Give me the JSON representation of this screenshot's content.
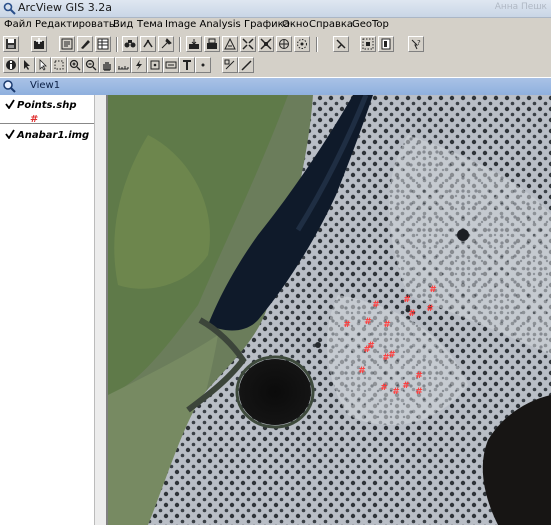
{
  "window": {
    "title": "ArcView GIS 3.2a",
    "faded_corner_text": "Анна Пешк"
  },
  "menu": [
    "Файл",
    "Редактировать",
    "Вид",
    "Тема",
    "Image Analysis",
    "Графика",
    "Окно",
    "Справка",
    "GeoTop"
  ],
  "toolbar1": [
    "save-icon",
    "add-theme-icon",
    "theme-properties-icon",
    "edit-legend-icon",
    "open-table-icon",
    "find-icon",
    "locate-address-icon",
    "query-builder-icon",
    "zoom-full-icon",
    "zoom-to-themes-icon",
    "zoom-to-selected-icon",
    "zoom-in-icon",
    "zoom-out-icon",
    "zoom-previous-icon",
    "select-by-theme-icon",
    "clear-selection-icon",
    "layout-icon",
    "help-icon"
  ],
  "toolbar2": [
    "identify-icon",
    "pointer-icon",
    "vertex-edit-icon",
    "select-feature-icon",
    "zoom-in-tool-icon",
    "zoom-out-tool-icon",
    "pan-icon",
    "measure-icon",
    "hotlink-icon",
    "area-of-interest-icon",
    "label-icon",
    "text-tool-icon",
    "draw-point-icon",
    "snap-icon",
    "line-tool-icon"
  ],
  "document": {
    "title": "View1"
  },
  "toc": {
    "layers": [
      {
        "name": "Points.shp",
        "visible": true,
        "legend_symbol": "#"
      },
      {
        "name": "Anabar1.img",
        "visible": true
      }
    ]
  },
  "map": {
    "points_color": "#ff3b3b",
    "point_symbol": "#",
    "points": [
      {
        "label": "#"
      },
      {
        "label": "#"
      },
      {
        "label": "#"
      },
      {
        "label": "#"
      },
      {
        "label": "#"
      },
      {
        "label": "#"
      },
      {
        "label": "#"
      },
      {
        "label": "#"
      },
      {
        "label": "#"
      },
      {
        "label": "#"
      },
      {
        "label": "#"
      },
      {
        "label": "#"
      },
      {
        "label": "#"
      },
      {
        "label": "#"
      },
      {
        "label": "#"
      },
      {
        "label": "#"
      },
      {
        "label": "#"
      },
      {
        "label": "#"
      }
    ]
  }
}
